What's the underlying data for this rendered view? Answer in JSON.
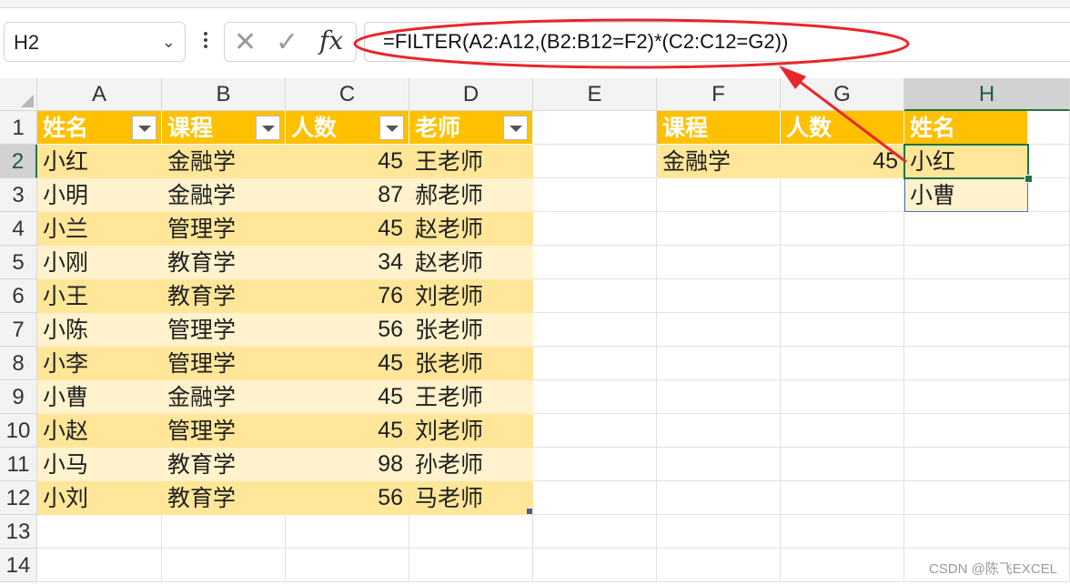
{
  "name_box": {
    "value": "H2"
  },
  "formula_bar": {
    "formula": "=FILTER(A2:A12,(B2:B12=F2)*(C2:C12=G2))"
  },
  "column_headers": [
    "A",
    "B",
    "C",
    "D",
    "E",
    "F",
    "G",
    "H"
  ],
  "row_numbers": [
    "1",
    "2",
    "3",
    "4",
    "5",
    "6",
    "7",
    "8",
    "9",
    "10",
    "11",
    "12",
    "13",
    "14"
  ],
  "table": {
    "headers": [
      "姓名",
      "课程",
      "人数",
      "老师"
    ],
    "rows": [
      [
        "小红",
        "金融学",
        "45",
        "王老师"
      ],
      [
        "小明",
        "金融学",
        "87",
        "郝老师"
      ],
      [
        "小兰",
        "管理学",
        "45",
        "赵老师"
      ],
      [
        "小刚",
        "教育学",
        "34",
        "赵老师"
      ],
      [
        "小王",
        "教育学",
        "76",
        "刘老师"
      ],
      [
        "小陈",
        "管理学",
        "56",
        "张老师"
      ],
      [
        "小李",
        "管理学",
        "45",
        "张老师"
      ],
      [
        "小曹",
        "金融学",
        "45",
        "王老师"
      ],
      [
        "小赵",
        "管理学",
        "45",
        "刘老师"
      ],
      [
        "小马",
        "教育学",
        "98",
        "孙老师"
      ],
      [
        "小刘",
        "教育学",
        "56",
        "马老师"
      ]
    ]
  },
  "criteria": {
    "headers": [
      "课程",
      "人数",
      "姓名"
    ],
    "course": "金融学",
    "count": "45",
    "results": [
      "小红",
      "小曹"
    ]
  },
  "selected_column": "H",
  "selected_row": "2",
  "colors": {
    "header_fill": "#ffc000",
    "band_dark": "#ffe699",
    "band_light": "#fff2cc",
    "selection": "#217346",
    "annotation": "#e8262b"
  },
  "watermark": "CSDN @陈飞EXCEL"
}
